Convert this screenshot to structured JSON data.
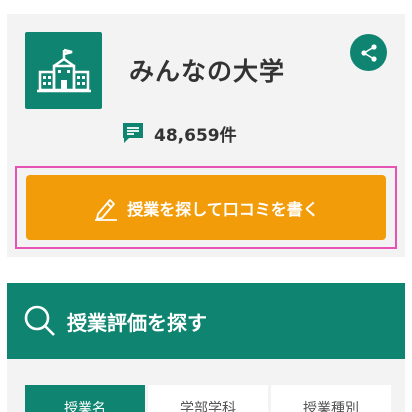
{
  "app": {
    "title": "みんなの大学",
    "review_count": "48,659件",
    "logo_icon": "school-building-icon",
    "share_icon": "share-icon"
  },
  "cta": {
    "label": "授業を探して口コミを書く",
    "icon": "pencil-icon"
  },
  "search": {
    "title": "授業評価を探す",
    "icon": "search-icon"
  },
  "tabs": [
    {
      "label": "授業名",
      "active": true
    },
    {
      "label": "学部学科",
      "active": false
    },
    {
      "label": "授業種別",
      "active": false
    }
  ],
  "colors": {
    "brand_green": "#0f8571",
    "cta_orange": "#f39c0a",
    "highlight_pink": "#e653b5",
    "card_bg": "#f3f3f3"
  }
}
